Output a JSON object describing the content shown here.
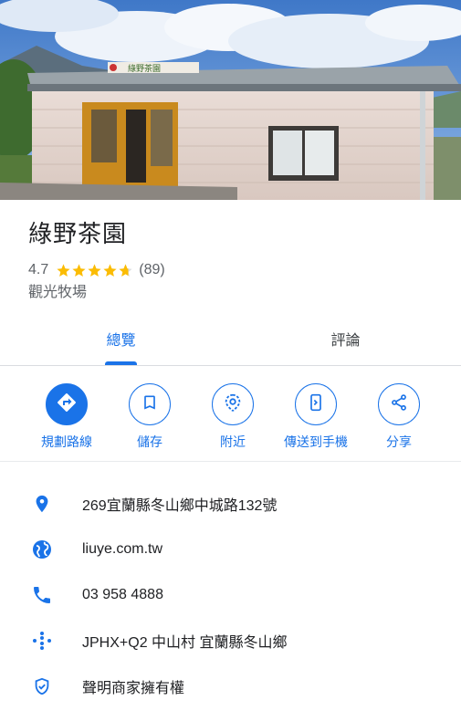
{
  "place": {
    "name": "綠野茶園",
    "rating": "4.7",
    "stars_fraction": 0.94,
    "review_count": "(89)",
    "category": "觀光牧場",
    "sign_text": "綠野茶園"
  },
  "tabs": [
    {
      "label": "總覽",
      "selected": true
    },
    {
      "label": "評論",
      "selected": false
    }
  ],
  "actions": [
    {
      "label": "規劃路線",
      "icon": "directions-icon"
    },
    {
      "label": "儲存",
      "icon": "bookmark-icon"
    },
    {
      "label": "附近",
      "icon": "nearby-icon"
    },
    {
      "label": "傳送到手機",
      "icon": "send-to-phone-icon"
    },
    {
      "label": "分享",
      "icon": "share-icon"
    }
  ],
  "details": [
    {
      "text": "269宜蘭縣冬山鄉中城路132號",
      "icon": "location-pin-icon"
    },
    {
      "text": "liuye.com.tw",
      "icon": "globe-icon"
    },
    {
      "text": "03 958 4888",
      "icon": "phone-icon"
    },
    {
      "text": "JPHX+Q2 中山村 宜蘭縣冬山鄉",
      "icon": "plus-code-icon"
    },
    {
      "text": "聲明商家擁有權",
      "icon": "shield-check-icon"
    }
  ],
  "colors": {
    "accent": "#1a73e8",
    "star": "#fbbc04",
    "text": "#202124",
    "secondary": "#5f6368"
  }
}
